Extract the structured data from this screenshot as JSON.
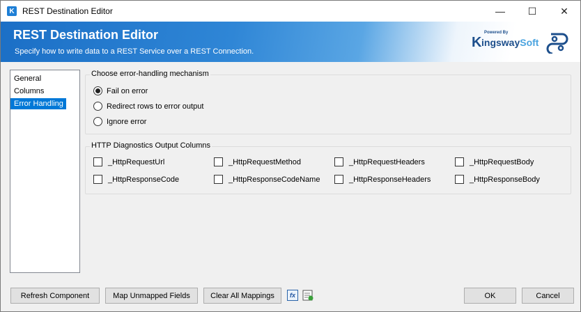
{
  "window": {
    "title": "REST Destination Editor",
    "controls": {
      "minimize": "—",
      "maximize": "☐",
      "close": "✕"
    }
  },
  "banner": {
    "title": "REST Destination Editor",
    "subtitle": "Specify how to write data to a REST Service over a REST Connection.",
    "logo_powered": "Powered By",
    "logo_brand_1": "ingsway",
    "logo_brand_2": "Soft",
    "logo_k": "K"
  },
  "nav": {
    "items": [
      {
        "label": "General"
      },
      {
        "label": "Columns"
      },
      {
        "label": "Error Handling",
        "selected": true
      }
    ]
  },
  "error_handling": {
    "title": "Choose error-handling mechanism",
    "options": [
      {
        "label": "Fail on error",
        "selected": true
      },
      {
        "label": "Redirect rows to error output",
        "selected": false
      },
      {
        "label": "Ignore error",
        "selected": false
      }
    ]
  },
  "diagnostics": {
    "title": "HTTP Diagnostics Output Columns",
    "columns": [
      {
        "label": "_HttpRequestUrl",
        "checked": false
      },
      {
        "label": "_HttpRequestMethod",
        "checked": false
      },
      {
        "label": "_HttpRequestHeaders",
        "checked": false
      },
      {
        "label": "_HttpRequestBody",
        "checked": false
      },
      {
        "label": "_HttpResponseCode",
        "checked": false
      },
      {
        "label": "_HttpResponseCodeName",
        "checked": false
      },
      {
        "label": "_HttpResponseHeaders",
        "checked": false
      },
      {
        "label": "_HttpResponseBody",
        "checked": false
      }
    ]
  },
  "buttons": {
    "refresh": "Refresh Component",
    "map_unmapped": "Map Unmapped Fields",
    "clear_mappings": "Clear All Mappings",
    "expression_icon": "fx",
    "ok": "OK",
    "cancel": "Cancel"
  },
  "icons": {
    "app": "kingswaysoft-app-icon",
    "expression": "function-icon",
    "variables": "variables-icon",
    "brand": "rest-brand-icon"
  },
  "colors": {
    "banner_start": "#1b6fc6",
    "selection": "#0078d7"
  }
}
